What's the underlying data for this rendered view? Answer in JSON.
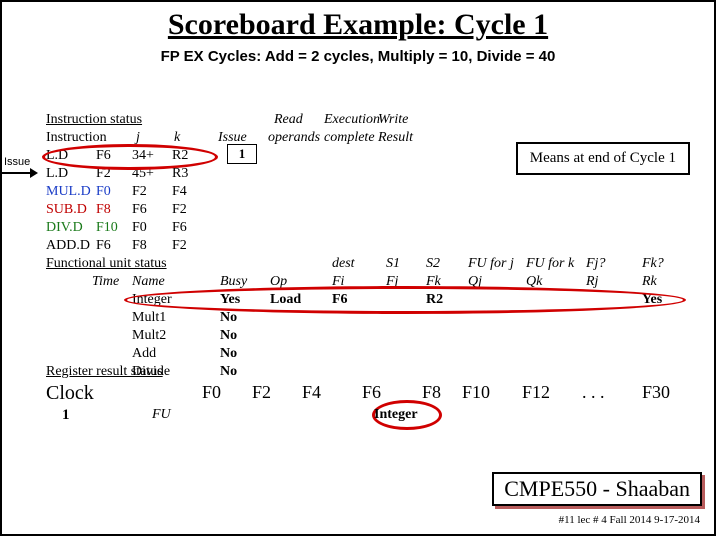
{
  "title_a": "Scoreboard Example:",
  "title_b": "  Cycle 1",
  "subtitle": "FP EX Cycles:  Add = 2 cycles, Multiply = 10, Divide = 40",
  "issue_side_label": "Issue",
  "instr_status": {
    "header": "Instruction status",
    "cols": {
      "instr": "Instruction",
      "j": "j",
      "k": "k",
      "issue": "Issue",
      "read": "Read",
      "exec": "Execution",
      "write": "Write",
      "ops": "operands",
      "comp": "complete",
      "res": "Result"
    },
    "rows": [
      {
        "op": "L.D",
        "dest": "F6",
        "j": "34+",
        "k": "R2",
        "cls": ""
      },
      {
        "op": "L.D",
        "dest": "F2",
        "j": "45+",
        "k": "R3",
        "cls": ""
      },
      {
        "op": "MUL.D",
        "dest": "F0",
        "j": "F2",
        "k": "F4",
        "cls": "mul"
      },
      {
        "op": "SUB.D",
        "dest": "F8",
        "j": "F6",
        "k": "F2",
        "cls": "sub"
      },
      {
        "op": "DIV.D",
        "dest": "F10",
        "j": "F0",
        "k": "F6",
        "cls": "div"
      },
      {
        "op": "ADD.D",
        "dest": "F6",
        "j": "F8",
        "k": "F2",
        "cls": ""
      }
    ],
    "issue_val": "1"
  },
  "means_box": "Means at end of Cycle 1",
  "fu_status": {
    "header": "Functional unit status",
    "cols": {
      "time": "Time",
      "name": "Name",
      "busy": "Busy",
      "op": "Op",
      "dest": "dest",
      "fi": "Fi",
      "s1": "S1",
      "fj": "Fj",
      "s2": "S2",
      "fk": "Fk",
      "fuj": "FU for j",
      "qj": "Qj",
      "fuk": "FU for k",
      "qk": "Qk",
      "fjq": "Fj?",
      "rj": "Rj",
      "fkq": "Fk?",
      "rk": "Rk"
    },
    "rows": [
      {
        "name": "Integer",
        "busy": "Yes",
        "op": "Load",
        "fi": "F6",
        "fj": "",
        "fk": "R2",
        "qj": "",
        "qk": "",
        "rj": "",
        "rk": "Yes"
      },
      {
        "name": "Mult1",
        "busy": "No"
      },
      {
        "name": "Mult2",
        "busy": "No"
      },
      {
        "name": "Add",
        "busy": "No"
      },
      {
        "name": "Divide",
        "busy": "No"
      }
    ]
  },
  "reg_status": {
    "header": "Register result status",
    "clock_label": "Clock",
    "clock_val": "1",
    "fu_label": "FU",
    "regs": [
      "F0",
      "F2",
      "F4",
      "F6",
      "F8",
      "F10",
      "F12",
      ". . .",
      "F30"
    ],
    "vals": {
      "F6": "Integer"
    }
  },
  "footer": "CMPE550 - Shaaban",
  "footer_small": "#11  lec # 4 Fall 2014   9-17-2014"
}
